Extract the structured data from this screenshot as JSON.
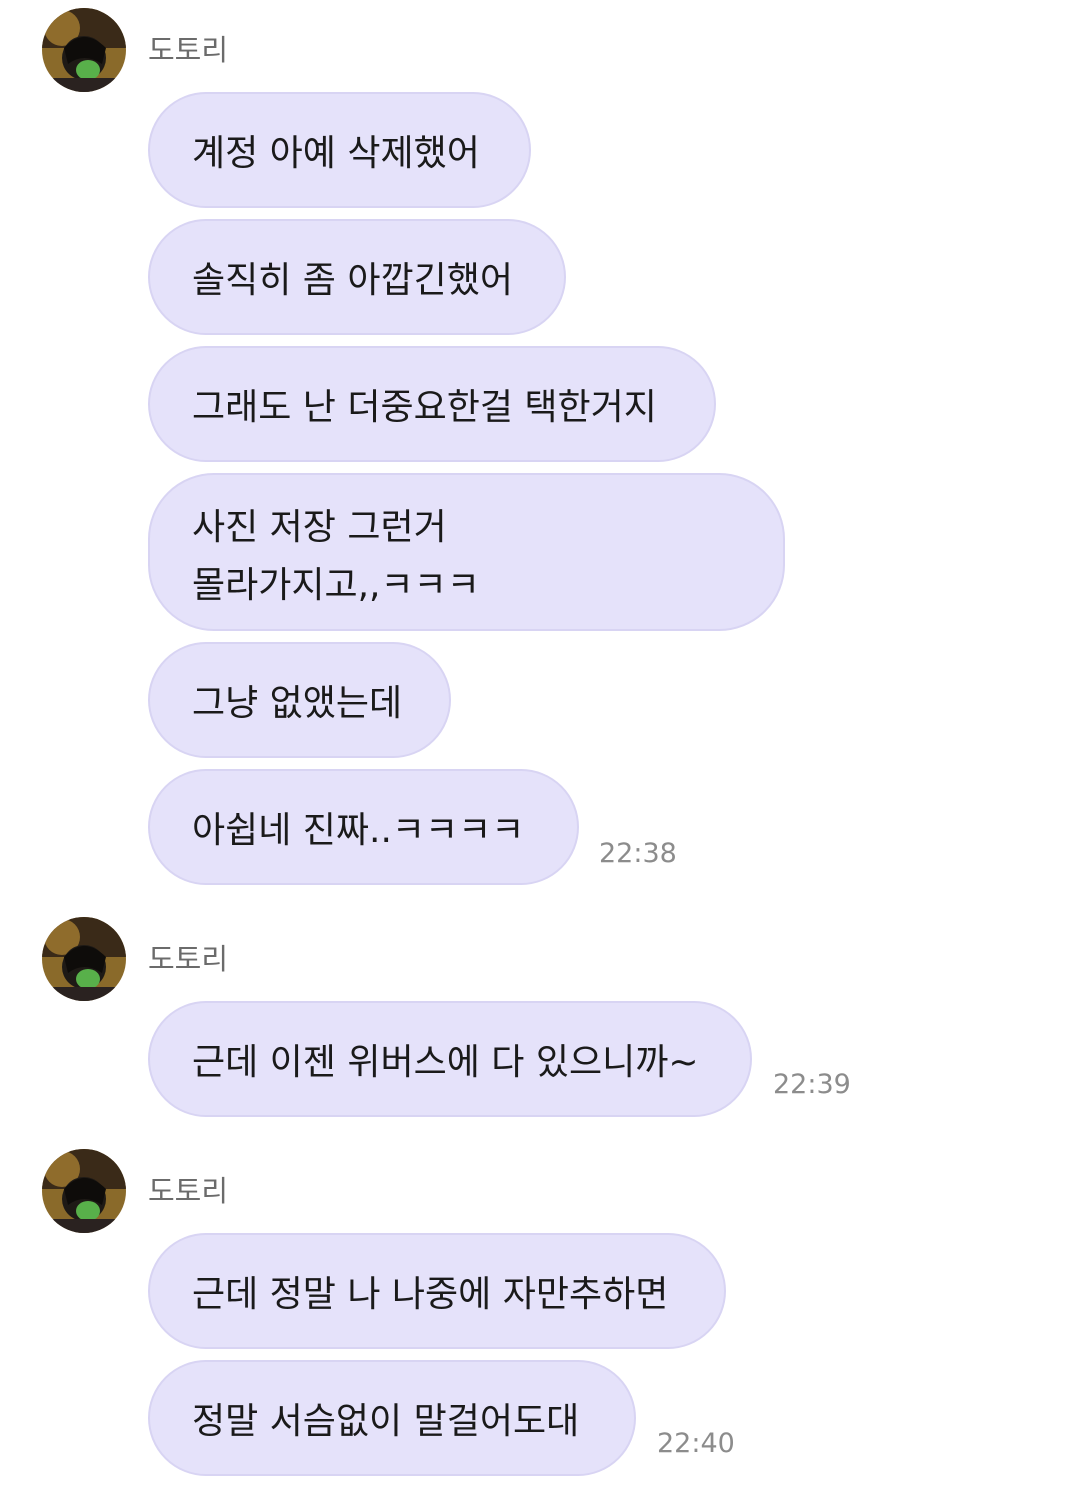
{
  "groups": [
    {
      "sender": "도토리",
      "messages": [
        "계정 아예 삭제했어",
        "솔직히 좀 아깝긴했어",
        "그래도 난 더중요한걸 택한거지",
        [
          "사진 저장 그런거",
          "몰라가지고,,ㅋㅋㅋ"
        ],
        "그냥 없앴는데",
        "아쉽네 진짜..ㅋㅋㅋㅋ"
      ],
      "time": "22:38"
    },
    {
      "sender": "도토리",
      "messages": [
        "근데 이젠 위버스에 다 있으니까~"
      ],
      "time": "22:39"
    },
    {
      "sender": "도토리",
      "messages": [
        "근데 정말 나 나중에 자만추하면",
        "정말 서슴없이 말걸어도대"
      ],
      "time": "22:40"
    }
  ],
  "colors": {
    "bubble": "#e5e2fa",
    "bubble_border": "#d8d4f3",
    "name": "#6b6b6b",
    "time": "#8c8c8c"
  },
  "icons": {
    "avatar": "profile-photo"
  }
}
